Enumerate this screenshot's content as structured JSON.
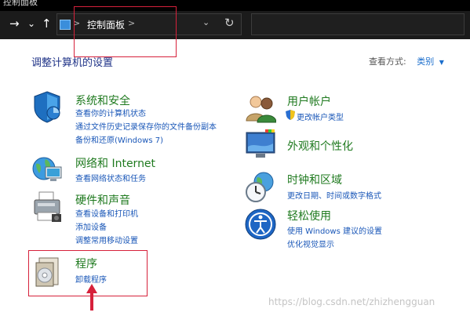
{
  "window": {
    "title": "控制面板"
  },
  "nav": {
    "back": "→",
    "dropdown": "⌄",
    "up": "↑"
  },
  "address": {
    "path": "控制面板",
    "sep": ">"
  },
  "page": {
    "heading": "调整计算机的设置"
  },
  "view_by": {
    "label": "查看方式:",
    "value": "类别"
  },
  "categories_left": [
    {
      "title": "系统和安全",
      "links": [
        "查看你的计算机状态",
        "通过文件历史记录保存你的文件备份副本",
        "备份和还原(Windows 7)"
      ],
      "icon": "shield-icon"
    },
    {
      "title": "网络和 Internet",
      "links": [
        "查看网络状态和任务"
      ],
      "icon": "network-globe-icon"
    },
    {
      "title": "硬件和声音",
      "links": [
        "查看设备和打印机",
        "添加设备",
        "调整常用移动设置"
      ],
      "icon": "printer-icon"
    },
    {
      "title": "程序",
      "links": [
        "卸载程序"
      ],
      "icon": "programs-icon"
    }
  ],
  "categories_right": [
    {
      "title": "用户帐户",
      "links": [
        "更改帐户类型"
      ],
      "icon": "users-icon"
    },
    {
      "title": "外观和个性化",
      "links": [],
      "icon": "monitor-icon"
    },
    {
      "title": "时钟和区域",
      "links": [
        "更改日期、时间或数字格式"
      ],
      "icon": "clock-globe-icon"
    },
    {
      "title": "轻松使用",
      "links": [
        "使用 Windows 建议的设置",
        "优化视觉显示"
      ],
      "icon": "accessibility-icon"
    }
  ],
  "watermark": "https://blog.csdn.net/zhizhengguan",
  "colors": {
    "heading_green": "#1f7a1f",
    "link_blue": "#1a57b8",
    "annotation_red": "#d6213b"
  }
}
